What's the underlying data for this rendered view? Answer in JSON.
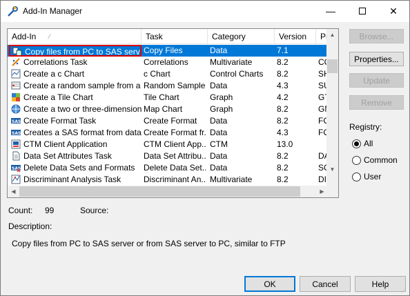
{
  "window": {
    "title": "Add-In Manager"
  },
  "columns": {
    "addin": "Add-In",
    "task": "Task",
    "category": "Category",
    "version": "Version",
    "pro": "Pro"
  },
  "rows": [
    {
      "addin": "Copy files from PC to SAS server ...",
      "task": "Copy Files",
      "category": "Data",
      "version": "7.1",
      "pro": "",
      "icon": "copy-files-icon"
    },
    {
      "addin": "Correlations Task",
      "task": "Correlations",
      "category": "Multivariate",
      "version": "8.2",
      "pro": "CO",
      "icon": "correlation-icon"
    },
    {
      "addin": "Create a c Chart",
      "task": "c Chart",
      "category": "Control Charts",
      "version": "8.2",
      "pro": "SH",
      "icon": "control-chart-icon"
    },
    {
      "addin": "Create a random sample from a d...",
      "task": "Random Sample",
      "category": "Data",
      "version": "4.3",
      "pro": "SU",
      "icon": "sample-icon"
    },
    {
      "addin": "Create a Tile Chart",
      "task": "Tile Chart",
      "category": "Graph",
      "version": "4.2",
      "pro": "GT",
      "icon": "tile-chart-icon"
    },
    {
      "addin": "Create a two or three-dimensional...",
      "task": "Map Chart",
      "category": "Graph",
      "version": "8.2",
      "pro": "GM",
      "icon": "globe-icon"
    },
    {
      "addin": "Create Format Task",
      "task": "Create Format",
      "category": "Data",
      "version": "8.2",
      "pro": "FO",
      "icon": "sas-format-icon"
    },
    {
      "addin": "Creates a SAS format from data v...",
      "task": "Create Format fr...",
      "category": "Data",
      "version": "4.3",
      "pro": "FO",
      "icon": "sas-format-icon"
    },
    {
      "addin": "CTM Client Application",
      "task": "CTM Client App...",
      "category": "CTM",
      "version": "13.0",
      "pro": "",
      "icon": "ctm-icon"
    },
    {
      "addin": "Data Set Attributes Task",
      "task": "Data Set Attribu...",
      "category": "Data",
      "version": "8.2",
      "pro": "DA",
      "icon": "document-icon"
    },
    {
      "addin": "Delete Data Sets and Formats",
      "task": "Delete Data Set...",
      "category": "Data",
      "version": "8.2",
      "pro": "SO",
      "icon": "sas-delete-icon"
    },
    {
      "addin": "Discriminant Analysis Task",
      "task": "Discriminant An...",
      "category": "Multivariate",
      "version": "8.2",
      "pro": "DI",
      "icon": "discriminant-icon"
    }
  ],
  "side_buttons": {
    "browse": "Browse...",
    "properties": "Properties...",
    "update": "Update",
    "remove": "Remove"
  },
  "registry": {
    "label": "Registry:",
    "options": [
      "All",
      "Common",
      "User"
    ],
    "selected": "All"
  },
  "info": {
    "count_label": "Count:",
    "count_value": "99",
    "source_label": "Source:",
    "source_value": "",
    "description_label": "Description:",
    "description_text": "Copy files from PC to SAS server or from SAS server to PC, similar to FTP"
  },
  "buttons": {
    "ok": "OK",
    "cancel": "Cancel",
    "help": "Help"
  },
  "colors": {
    "selection": "#0078d7",
    "highlight_border": "#dd0000"
  }
}
